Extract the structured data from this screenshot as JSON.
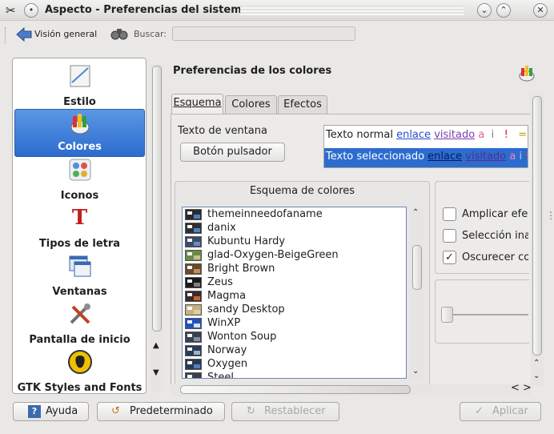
{
  "window": {
    "title": "Aspecto - Preferencias del sistema",
    "app_icon": "tools-icon",
    "menu_icon": "window-menu-icon"
  },
  "toolbar": {
    "overview_label": "Visión general",
    "search_label": "Buscar:",
    "search_value": ""
  },
  "sidebar": {
    "items": [
      {
        "label": "Estilo",
        "icon": "style-icon",
        "selected": false
      },
      {
        "label": "Colores",
        "icon": "colors-icon",
        "selected": true
      },
      {
        "label": "Iconos",
        "icon": "icons-icon",
        "selected": false
      },
      {
        "label": "Tipos de letra",
        "icon": "fonts-icon",
        "selected": false
      },
      {
        "label": "Ventanas",
        "icon": "windows-icon",
        "selected": false
      },
      {
        "label": "Pantalla de inicio",
        "icon": "splash-screen-icon",
        "selected": false
      },
      {
        "label": "GTK Styles and Fonts",
        "icon": "gtk-icon",
        "selected": false
      }
    ]
  },
  "main": {
    "title": "Preferencias de los colores",
    "tabs": [
      {
        "label": "Esquema",
        "active": true
      },
      {
        "label": "Colores",
        "active": false
      },
      {
        "label": "Efectos",
        "active": false
      }
    ],
    "window_text_label": "Texto de ventana",
    "push_button_label": "Botón pulsador",
    "preview": {
      "normal": {
        "text": "Texto normal",
        "link": "enlace",
        "visited": "visitado",
        "a": "a",
        "i": "i",
        "excl": "!",
        "eq": "="
      },
      "selected": {
        "text": "Texto seleccionado",
        "link": "enlace",
        "visited": "visitado",
        "a": "a",
        "i": "i",
        "excl": "!",
        "eq": "="
      }
    },
    "scheme_group_title": "Esquema de colores",
    "schemes": [
      {
        "name": "themeinneedofaname",
        "c1": "#2a2a2a",
        "c2": "#4a80c0"
      },
      {
        "name": "danix",
        "c1": "#303030",
        "c2": "#5080c8"
      },
      {
        "name": "Kubuntu Hardy",
        "c1": "#3a4a6a",
        "c2": "#6a8ac0"
      },
      {
        "name": "glad-Oxygen-BeigeGreen",
        "c1": "#6a8a4a",
        "c2": "#c8c090"
      },
      {
        "name": "Bright Brown",
        "c1": "#6a4a2a",
        "c2": "#c09060"
      },
      {
        "name": "Zeus",
        "c1": "#1a1a1a",
        "c2": "#808080"
      },
      {
        "name": "Magma",
        "c1": "#3a2a2a",
        "c2": "#d06030"
      },
      {
        "name": "sandy Desktop",
        "c1": "#c8b080",
        "c2": "#e0d0a0"
      },
      {
        "name": "WinXP",
        "c1": "#2050c0",
        "c2": "#e0e0e0"
      },
      {
        "name": "Wonton Soup",
        "c1": "#3a4050",
        "c2": "#8090a8"
      },
      {
        "name": "Norway",
        "c1": "#2a3a5a",
        "c2": "#a0b0c8"
      },
      {
        "name": "Oxygen",
        "c1": "#2a3a50",
        "c2": "#5080c0"
      },
      {
        "name": "Steel",
        "c1": "#3a4048",
        "c2": "#9098a0"
      }
    ],
    "options": [
      {
        "label": "Amplicar efec",
        "checked": false
      },
      {
        "label": "Selección ina",
        "checked": false
      },
      {
        "label": "Oscurecer co",
        "checked": true
      }
    ]
  },
  "footer": {
    "help_label": "Ayuda",
    "defaults_label": "Predeterminado",
    "reset_label": "Restablecer",
    "apply_label": "Aplicar"
  },
  "colors": {
    "selection": "#2c6ccf",
    "link": "#2a4bd0",
    "visited": "#7a3cb0"
  }
}
